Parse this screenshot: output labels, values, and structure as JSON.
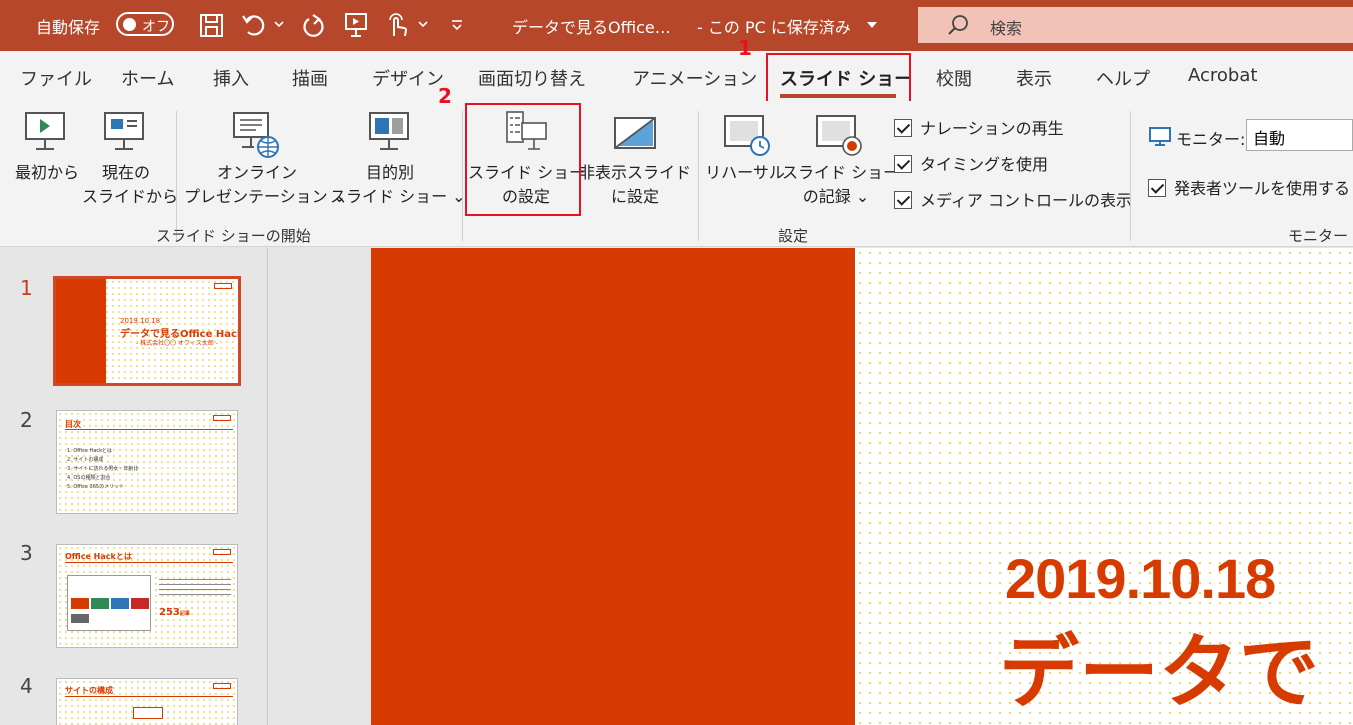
{
  "titlebar": {
    "autosave_label": "自動保存",
    "autosave_state": "オフ",
    "document_title": "データで見るOffice…",
    "save_status": "- この PC に保存済み",
    "search_label": "検索"
  },
  "tabs": [
    "ファイル",
    "ホーム",
    "挿入",
    "描画",
    "デザイン",
    "画面切り替え",
    "アニメーション",
    "スライド ショー",
    "校閲",
    "表示",
    "ヘルプ",
    "Acrobat"
  ],
  "annotations": {
    "step1": "1",
    "step2": "2"
  },
  "ribbon": {
    "start_group": {
      "label": "スライド ショーの開始",
      "from_beginning": [
        "最初から"
      ],
      "from_current": [
        "現在の",
        "スライドから"
      ],
      "online": [
        "オンライン",
        "プレゼンテーション ⌄"
      ],
      "custom": [
        "目的別",
        "スライド ショー ⌄"
      ]
    },
    "setup_group": {
      "label": "設定",
      "setup_show": [
        "スライド ショー",
        "の設定"
      ],
      "hide_slide": [
        "非表示スライド",
        "に設定"
      ],
      "rehearse": [
        "リハーサル"
      ],
      "record": [
        "スライド ショー",
        "の記録 ⌄"
      ],
      "checks": [
        "ナレーションの再生",
        "タイミングを使用",
        "メディア コントロールの表示"
      ]
    },
    "monitor_group": {
      "label": "モニター",
      "monitor_label": "モニター:",
      "monitor_value": "自動",
      "presenter_view": "発表者ツールを使用する"
    }
  },
  "slides": {
    "numbers": [
      "1",
      "2",
      "3",
      "4"
    ],
    "s1": {
      "date": "2019.10.18",
      "title": "データで見るOffice Hack",
      "sub": "- 株式会社〇〇 オフィス太郎 -"
    },
    "s2": {
      "heading": "目次",
      "items": [
        "1. Office Hackとは",
        "2. サイトの構成",
        "3. サイトに訪れる男女・年齢比",
        "4. OSの種類と割合",
        "5. Office 365のメリット"
      ]
    },
    "s3": {
      "heading": "Office Hackとは",
      "stat": "253",
      "stat_unit": "記事"
    },
    "s4": {
      "heading": "サイトの構成"
    }
  },
  "main_slide": {
    "date": "2019.10.18",
    "title": "データで"
  }
}
